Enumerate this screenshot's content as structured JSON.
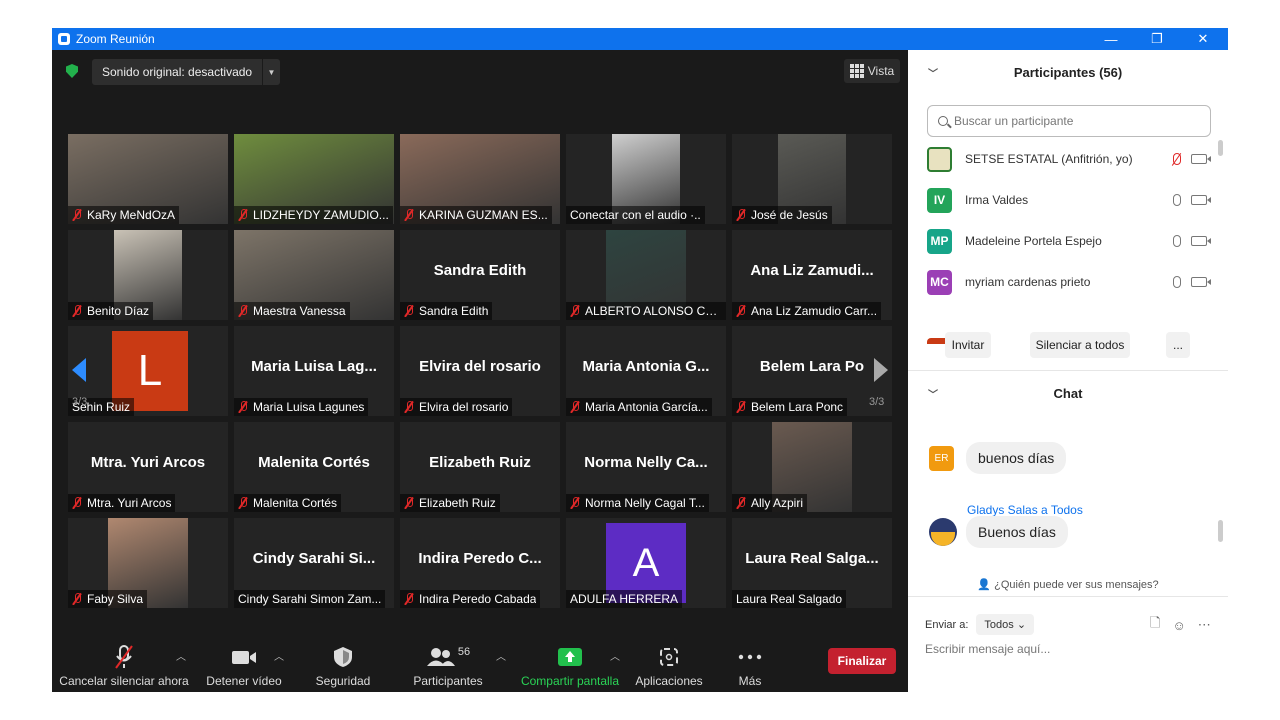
{
  "window": {
    "title": "Zoom Reunión",
    "minimize": "—",
    "restore": "❐",
    "close": "✕"
  },
  "topbar": {
    "sound_label": "Sonido original: desactivado",
    "view_label": "Vista"
  },
  "pagination": {
    "left": "3/3",
    "right": "3/3"
  },
  "tiles": [
    {
      "name": "KaRy MeNdOzA",
      "muted": true,
      "kind": "photo",
      "bg": "#7a6e62"
    },
    {
      "name": "LIDZHEYDY ZAMUDIO...",
      "muted": true,
      "kind": "photo",
      "bg": "#6f8d3e"
    },
    {
      "name": "KARINA GUZMAN ES...",
      "muted": true,
      "kind": "photo",
      "bg": "#8a6a5a"
    },
    {
      "name": "Conectar con el audio ·..",
      "muted": false,
      "kind": "photo",
      "bg": "#cfcfcf"
    },
    {
      "name": "José de Jesús",
      "muted": true,
      "kind": "photo",
      "bg": "#5a5a55"
    },
    {
      "name": "Benito Díaz",
      "muted": true,
      "kind": "photo",
      "bg": "#c9c2b6"
    },
    {
      "name": "Maestra Vanessa",
      "muted": true,
      "kind": "photo",
      "bg": "#7d7468"
    },
    {
      "name": "Sandra Edith",
      "muted": true,
      "big": "Sandra Edith",
      "kind": "name"
    },
    {
      "name": "ALBERTO ALONSO CE...",
      "muted": true,
      "kind": "photo",
      "bg": "#2e4440"
    },
    {
      "name": "Ana Liz Zamudio Carr...",
      "muted": true,
      "big": "Ana Liz Zamudi...",
      "kind": "name"
    },
    {
      "name": "Sehin Ruiz",
      "muted": false,
      "kind": "letter",
      "letter": "L"
    },
    {
      "name": "Maria Luisa Lagunes",
      "muted": true,
      "big": "Maria Luisa Lag...",
      "kind": "name"
    },
    {
      "name": "Elvira del rosario",
      "muted": true,
      "big": "Elvira del rosario",
      "kind": "name"
    },
    {
      "name": "Maria Antonia García...",
      "muted": true,
      "big": "Maria Antonia G...",
      "kind": "name"
    },
    {
      "name": "Belem Lara Ponc",
      "muted": true,
      "big": "Belem Lara Po",
      "kind": "name"
    },
    {
      "name": "Mtra. Yuri Arcos",
      "muted": true,
      "big": "Mtra. Yuri Arcos",
      "kind": "name"
    },
    {
      "name": "Malenita Cortés",
      "muted": true,
      "big": "Malenita Cortés",
      "kind": "name"
    },
    {
      "name": "Elizabeth Ruiz",
      "muted": true,
      "big": "Elizabeth Ruiz",
      "kind": "name"
    },
    {
      "name": "Norma Nelly Cagal T...",
      "muted": true,
      "big": "Norma Nelly Ca...",
      "kind": "name"
    },
    {
      "name": "Ally Azpiri",
      "muted": true,
      "kind": "photo",
      "bg": "#6a5a50"
    },
    {
      "name": "Faby Silva",
      "muted": true,
      "kind": "photo",
      "bg": "#b08870"
    },
    {
      "name": "Cindy Sarahi Simon Zam...",
      "muted": false,
      "big": "Cindy Sarahi Si...",
      "kind": "name"
    },
    {
      "name": "Indira Peredo Cabada",
      "muted": true,
      "big": "Indira Peredo C...",
      "kind": "name"
    },
    {
      "name": "ADULFA HERRERA",
      "muted": false,
      "kind": "letter",
      "letter": "A"
    },
    {
      "name": "Laura Real Salgado",
      "muted": false,
      "big": "Laura Real Salga...",
      "kind": "name"
    }
  ],
  "toolbar": {
    "mute": "Cancelar silenciar ahora",
    "video": "Detener vídeo",
    "security": "Seguridad",
    "participants": "Participantes",
    "participants_count": "56",
    "share": "Compartir pantalla",
    "apps": "Aplicaciones",
    "more": "Más",
    "end": "Finalizar"
  },
  "participants_panel": {
    "title": "Participantes (56)",
    "search_placeholder": "Buscar un participante",
    "list": [
      {
        "initials": "",
        "name": "SETSE ESTATAL (Anfitrión, yo)",
        "color": "#e8e2c0",
        "muted": true
      },
      {
        "initials": "IV",
        "name": "Irma Valdes",
        "color": "#23a45a",
        "muted": false
      },
      {
        "initials": "MP",
        "name": "Madeleine Portela Espejo",
        "color": "#17a589",
        "muted": false
      },
      {
        "initials": "MC",
        "name": "myriam cardenas prieto",
        "color": "#9b3fb5",
        "muted": false
      }
    ],
    "invite": "Invitar",
    "mute_all": "Silenciar a todos",
    "more": "..."
  },
  "chat": {
    "title": "Chat",
    "msg1_avatar": "ER",
    "msg1": "buenos días",
    "sender2": "Gladys Salas a Todos",
    "msg2": "Buenos días",
    "who_can_see": "¿Quién puede ver sus mensajes?",
    "send_to_label": "Enviar a:",
    "send_to_value": "Todos",
    "input_placeholder": "Escribir mensaje aquí..."
  }
}
